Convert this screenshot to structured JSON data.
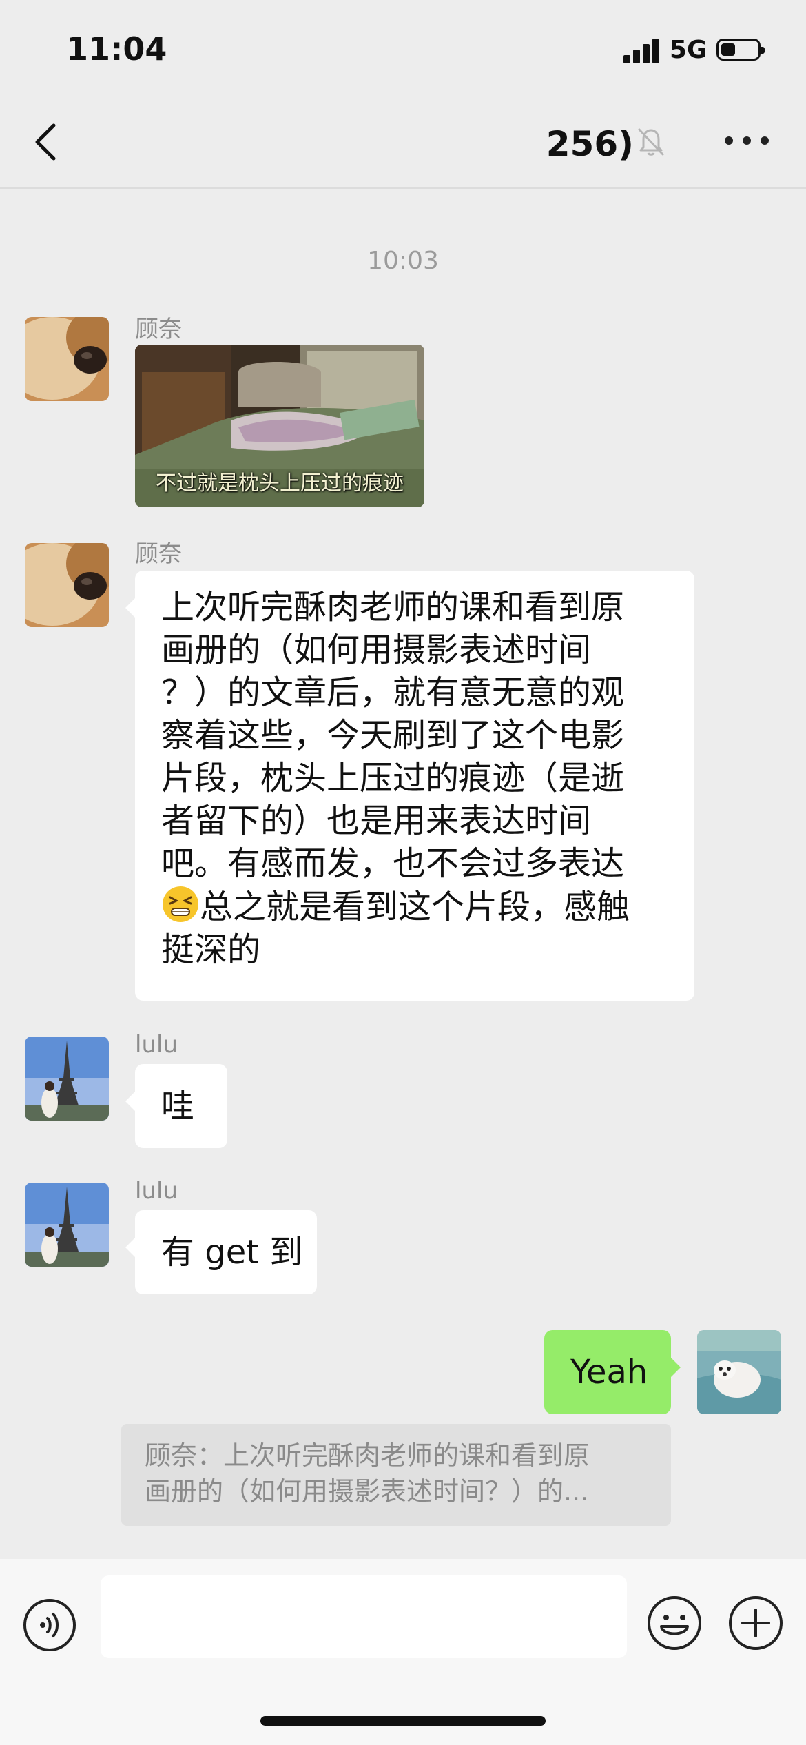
{
  "status_bar": {
    "time": "11:04",
    "network": "5G"
  },
  "nav": {
    "title": "256)",
    "back_icon": "chevron-left-icon",
    "mute_icon": "bell-slash-icon",
    "more_icon": "ellipsis-icon"
  },
  "chat": {
    "timestamp": "10:03",
    "messages": [
      {
        "sender": "顾奈",
        "type": "image",
        "caption": "不过就是枕头上压过的痕迹"
      },
      {
        "sender": "顾奈",
        "type": "text",
        "lines": [
          "上次听完酥肉老师的课和看到原",
          "画册的（如何用摄影表述时间",
          "？）的文章后，就有意无意的观",
          "察着这些，今天刷到了这个电影",
          "片段，枕头上压过的痕迹（是逝",
          "者留下的）也是用来表达时间",
          "吧。有感而发，也不会过多表达"
        ],
        "emoji_line": "总之就是看到这个片段，感触",
        "last_line": "挺深的",
        "emoji": "grimacing-face-icon"
      },
      {
        "sender": "lulu",
        "type": "text",
        "text": "哇"
      },
      {
        "sender": "lulu",
        "type": "text",
        "text": "有 get 到"
      },
      {
        "sender": "me",
        "type": "text",
        "text": "Yeah"
      }
    ],
    "quote": {
      "line1": "顾奈：上次听完酥肉老师的课和看到原",
      "line2": "画册的（如何用摄影表述时间？）的..."
    }
  },
  "input_bar": {
    "voice_icon": "voice-icon",
    "emoji_icon": "smiley-icon",
    "plus_icon": "plus-circle-icon",
    "input_value": ""
  },
  "colors": {
    "background": "#ededed",
    "self_bubble": "#95ec69",
    "other_bubble": "#ffffff"
  }
}
